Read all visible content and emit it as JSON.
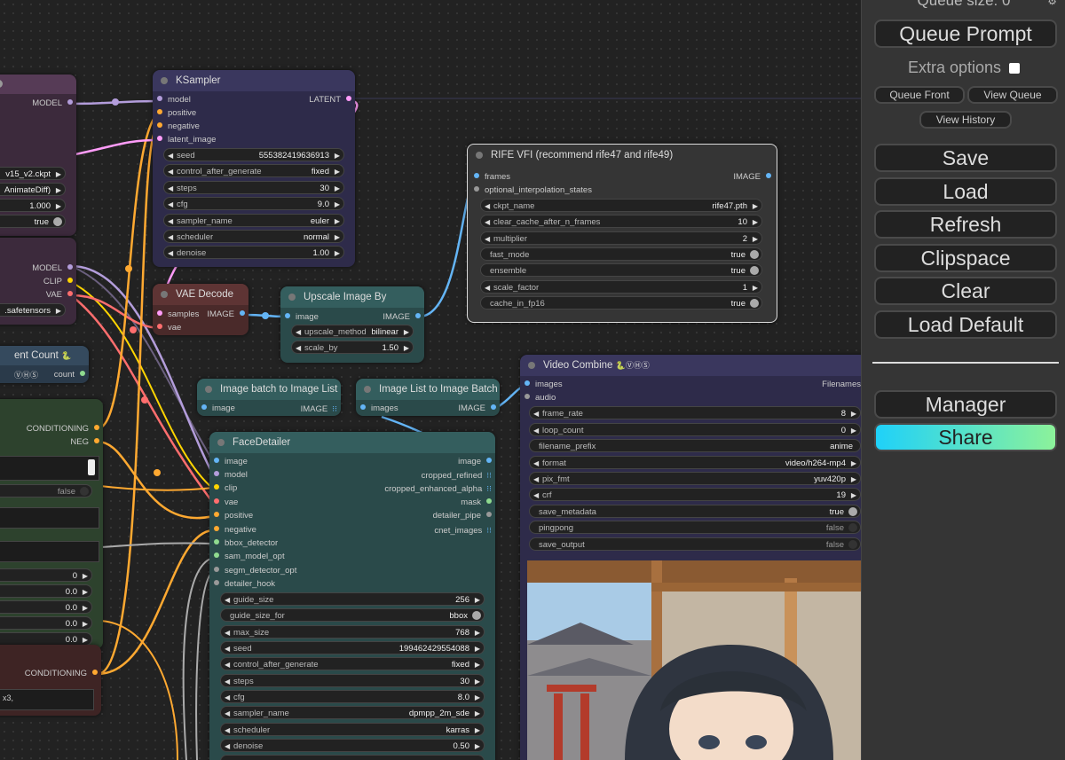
{
  "sidebar": {
    "queue_size": "Queue size: 0",
    "queue_prompt": "Queue Prompt",
    "extra_options": "Extra options",
    "queue_front": "Queue Front",
    "view_queue": "View Queue",
    "view_history": "View History",
    "save": "Save",
    "load": "Load",
    "refresh": "Refresh",
    "clipspace": "Clipspace",
    "clear": "Clear",
    "load_default": "Load Default",
    "manager": "Manager",
    "share": "Share"
  },
  "nodes": {
    "left1": {
      "model_out": "MODEL",
      "ckpt": "v15_v2.ckpt",
      "animatediff": "AnimateDiff)",
      "strength": "1.000",
      "toggle": "true"
    },
    "left2": {
      "model": "MODEL",
      "clip": "CLIP",
      "vae": "VAE",
      "safetensors": ".safetensors"
    },
    "left3": {
      "title": "ent Count",
      "count": "count"
    },
    "left4": {
      "conditioning": "CONDITIONING",
      "neg": "NEG",
      "false_val": "false",
      "v0": "0",
      "v1": "0.0",
      "v2": "0.0",
      "v3": "0.0",
      "v4": "0.0"
    },
    "left5": {
      "conditioning": "CONDITIONING",
      "text": "x3,"
    },
    "ksampler": {
      "title": "KSampler",
      "inputs": [
        "model",
        "positive",
        "negative",
        "latent_image"
      ],
      "output": "LATENT",
      "widgets": [
        {
          "name": "seed",
          "value": "555382419636913"
        },
        {
          "name": "control_after_generate",
          "value": "fixed"
        },
        {
          "name": "steps",
          "value": "30"
        },
        {
          "name": "cfg",
          "value": "9.0"
        },
        {
          "name": "sampler_name",
          "value": "euler"
        },
        {
          "name": "scheduler",
          "value": "normal"
        },
        {
          "name": "denoise",
          "value": "1.00"
        }
      ]
    },
    "vae_decode": {
      "title": "VAE Decode",
      "inputs": [
        "samples",
        "vae"
      ],
      "output": "IMAGE"
    },
    "upscale": {
      "title": "Upscale Image By",
      "input": "image",
      "output": "IMAGE",
      "widgets": [
        {
          "name": "upscale_method",
          "value": "bilinear"
        },
        {
          "name": "scale_by",
          "value": "1.50"
        }
      ]
    },
    "batch_to_list": {
      "title": "Image batch to Image List",
      "input": "image",
      "output": "IMAGE"
    },
    "list_to_batch": {
      "title": "Image List to Image Batch",
      "input": "images",
      "output": "IMAGE"
    },
    "rife": {
      "title": "RIFE VFI (recommend rife47 and rife49)",
      "inputs": [
        "frames",
        "optional_interpolation_states"
      ],
      "output": "IMAGE",
      "widgets": [
        {
          "name": "ckpt_name",
          "value": "rife47.pth"
        },
        {
          "name": "clear_cache_after_n_frames",
          "value": "10"
        },
        {
          "name": "multiplier",
          "value": "2"
        },
        {
          "name": "fast_mode",
          "value": "true"
        },
        {
          "name": "ensemble",
          "value": "true"
        },
        {
          "name": "scale_factor",
          "value": "1"
        },
        {
          "name": "cache_in_fp16",
          "value": "true"
        }
      ]
    },
    "video_combine": {
      "title": "Video Combine",
      "inputs": [
        "images",
        "audio"
      ],
      "output": "Filenames",
      "widgets": [
        {
          "name": "frame_rate",
          "value": "8"
        },
        {
          "name": "loop_count",
          "value": "0"
        },
        {
          "name": "filename_prefix",
          "value": "anime"
        },
        {
          "name": "format",
          "value": "video/h264-mp4"
        },
        {
          "name": "pix_fmt",
          "value": "yuv420p"
        },
        {
          "name": "crf",
          "value": "19"
        },
        {
          "name": "save_metadata",
          "value": "true"
        },
        {
          "name": "pingpong",
          "value": "false"
        },
        {
          "name": "save_output",
          "value": "false"
        }
      ]
    },
    "facedetailer": {
      "title": "FaceDetailer",
      "inputs": [
        "image",
        "model",
        "clip",
        "vae",
        "positive",
        "negative",
        "bbox_detector",
        "sam_model_opt",
        "segm_detector_opt",
        "detailer_hook"
      ],
      "outputs": [
        "image",
        "cropped_refined",
        "cropped_enhanced_alpha",
        "mask",
        "detailer_pipe",
        "cnet_images"
      ],
      "widgets": [
        {
          "name": "guide_size",
          "value": "256"
        },
        {
          "name": "guide_size_for",
          "value": "bbox"
        },
        {
          "name": "max_size",
          "value": "768"
        },
        {
          "name": "seed",
          "value": "199462429554088"
        },
        {
          "name": "control_after_generate",
          "value": "fixed"
        },
        {
          "name": "steps",
          "value": "30"
        },
        {
          "name": "cfg",
          "value": "8.0"
        },
        {
          "name": "sampler_name",
          "value": "dpmpp_2m_sde"
        },
        {
          "name": "scheduler",
          "value": "karras"
        },
        {
          "name": "denoise",
          "value": "0.50"
        }
      ]
    }
  },
  "colors": {
    "model_link": "#b39ddb",
    "conditioning_link": "#ffa931",
    "vae_link": "#ff6e6e",
    "image_link": "#64b5f6",
    "latent_link": "#ff9cf9",
    "accent_share_start": "#1fd1f9",
    "accent_share_end": "#8cf29a"
  }
}
